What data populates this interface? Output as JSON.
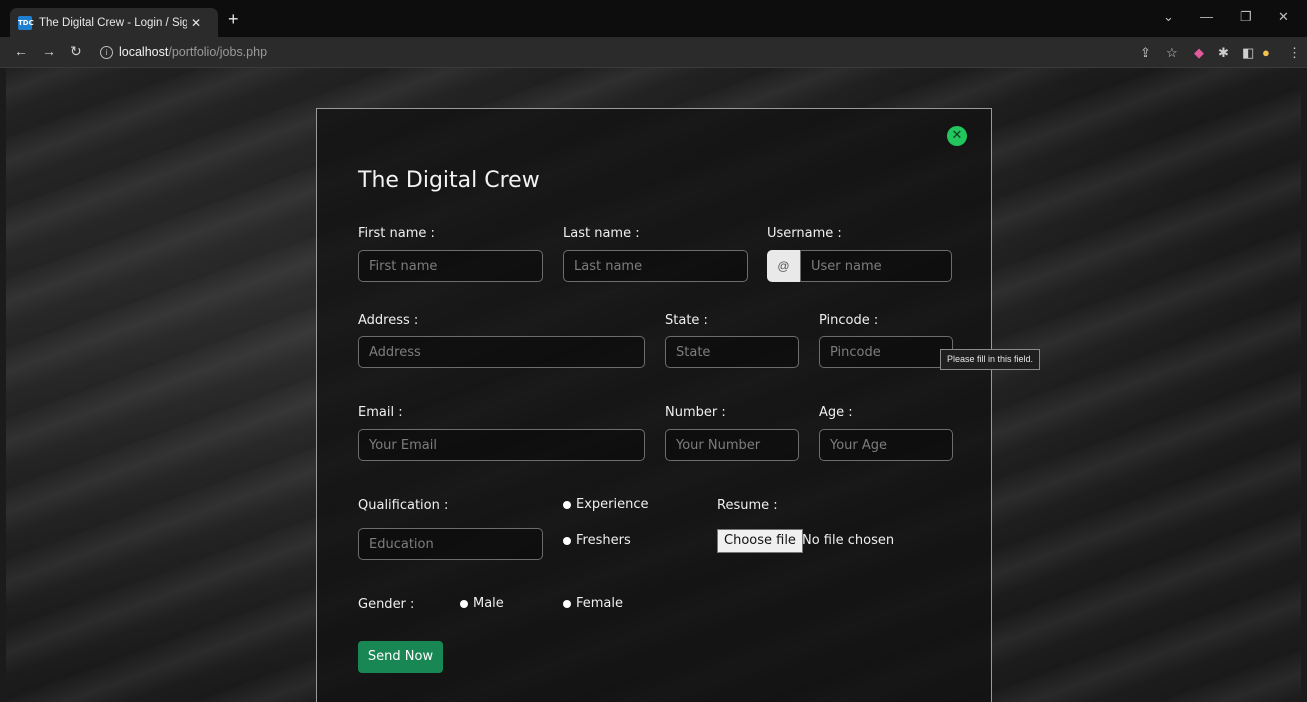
{
  "browser": {
    "tab_title": "The Digital Crew - Login / Sign up",
    "favicon_text": "TDC",
    "new_tab": "+",
    "url_host": "localhost",
    "url_path": "/portfolio/jobs.php"
  },
  "form": {
    "title": "The Digital Crew",
    "first_name": {
      "label": "First name :",
      "placeholder": "First name"
    },
    "last_name": {
      "label": "Last name :",
      "placeholder": "Last name"
    },
    "username": {
      "label": "Username :",
      "prefix": "@",
      "placeholder": "User name"
    },
    "address": {
      "label": "Address :",
      "placeholder": "Address"
    },
    "state": {
      "label": "State :",
      "placeholder": "State"
    },
    "pincode": {
      "label": "Pincode :",
      "placeholder": "Pincode"
    },
    "email": {
      "label": "Email :",
      "placeholder": "Your Email"
    },
    "number": {
      "label": "Number :",
      "placeholder": "Your Number"
    },
    "age": {
      "label": "Age :",
      "placeholder": "Your Age"
    },
    "qualification": {
      "label": "Qualification :",
      "placeholder": "Education"
    },
    "experience_options": [
      "Experience",
      "Freshers"
    ],
    "resume": {
      "label": "Resume :",
      "button": "Choose file",
      "status": "No file chosen"
    },
    "gender": {
      "label": "Gender :",
      "options": [
        "Male",
        "Female"
      ]
    },
    "submit_label": "Send Now",
    "validation_tooltip": "Please fill in this field."
  },
  "colors": {
    "accent_green": "#22c55e",
    "button_green": "#198754"
  }
}
